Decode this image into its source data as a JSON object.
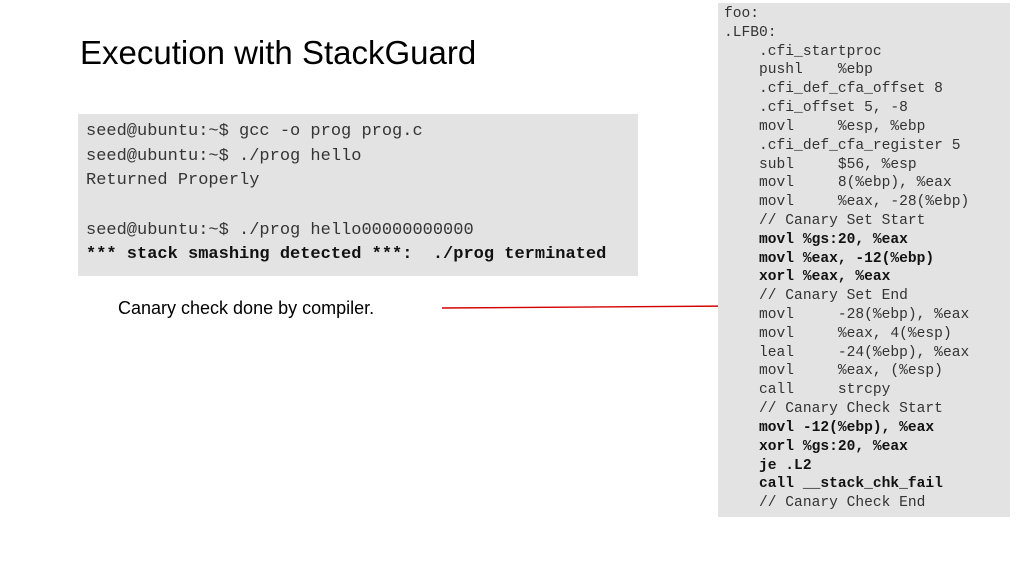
{
  "title": "Execution with StackGuard",
  "terminal": {
    "l1": "seed@ubuntu:~$ gcc -o prog prog.c",
    "l2": "seed@ubuntu:~$ ./prog hello",
    "l3": "Returned Properly",
    "l4": "",
    "l5": "seed@ubuntu:~$ ./prog hello00000000000",
    "l6": "*** stack smashing detected ***:  ./prog terminated"
  },
  "caption": "Canary check done by compiler.",
  "asm": {
    "a01": "foo:",
    "a02": ".LFB0:",
    "a03": "    .cfi_startproc",
    "a04": "    pushl    %ebp",
    "a05": "    .cfi_def_cfa_offset 8",
    "a06": "    .cfi_offset 5, -8",
    "a07": "    movl     %esp, %ebp",
    "a08": "    .cfi_def_cfa_register 5",
    "a09": "    subl     $56, %esp",
    "a10": "    movl     8(%ebp), %eax",
    "a11": "    movl     %eax, -28(%ebp)",
    "a12": "    // Canary Set Start",
    "a13": "    movl %gs:20, %eax",
    "a14": "    movl %eax, -12(%ebp)",
    "a15": "    xorl %eax, %eax",
    "a16": "    // Canary Set End",
    "a17": "    movl     -28(%ebp), %eax",
    "a18": "    movl     %eax, 4(%esp)",
    "a19": "    leal     -24(%ebp), %eax",
    "a20": "    movl     %eax, (%esp)",
    "a21": "    call     strcpy",
    "a22": "    // Canary Check Start",
    "a23": "    movl -12(%ebp), %eax",
    "a24": "    xorl %gs:20, %eax",
    "a25": "    je .L2",
    "a26": "    call __stack_chk_fail",
    "a27": "    // Canary Check End"
  }
}
